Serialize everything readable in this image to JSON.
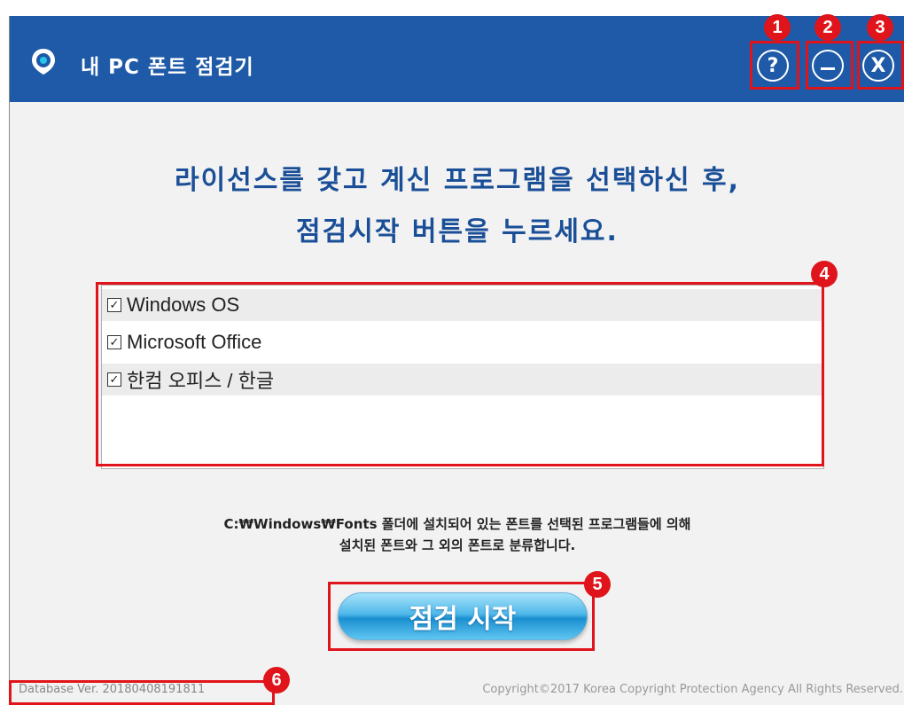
{
  "window": {
    "title": "내 PC 폰트 점검기",
    "buttons": {
      "help_label": "?",
      "close_label": "X"
    }
  },
  "instruction": {
    "line1": "라이선스를 갖고 계신 프로그램을 선택하신 후,",
    "line2": "점검시작 버튼을 누르세요."
  },
  "programs": [
    {
      "label": "Windows OS",
      "checked": true
    },
    {
      "label": "Microsoft Office",
      "checked": true
    },
    {
      "label": "한컴 오피스 / 한글",
      "checked": true
    }
  ],
  "check_mark": "✓",
  "note": {
    "line1": "C:₩Windows₩Fonts 폴더에 설치되어 있는 폰트를 선택된 프로그램들에 의해",
    "line2": "설치된 폰트와 그 외의 폰트로 분류합니다."
  },
  "start_button_label": "점검 시작",
  "footer": {
    "database_version": "Database Ver. 20180408191811",
    "copyright": "Copyright©2017 Korea Copyright Protection Agency All Rights Reserved."
  },
  "callouts": [
    "1",
    "2",
    "3",
    "4",
    "5",
    "6"
  ],
  "colors": {
    "titlebar": "#1e5aa8",
    "instruction_text": "#1a4f98",
    "callout_red": "#e0141b",
    "button_blue": "#1b8fd0"
  }
}
